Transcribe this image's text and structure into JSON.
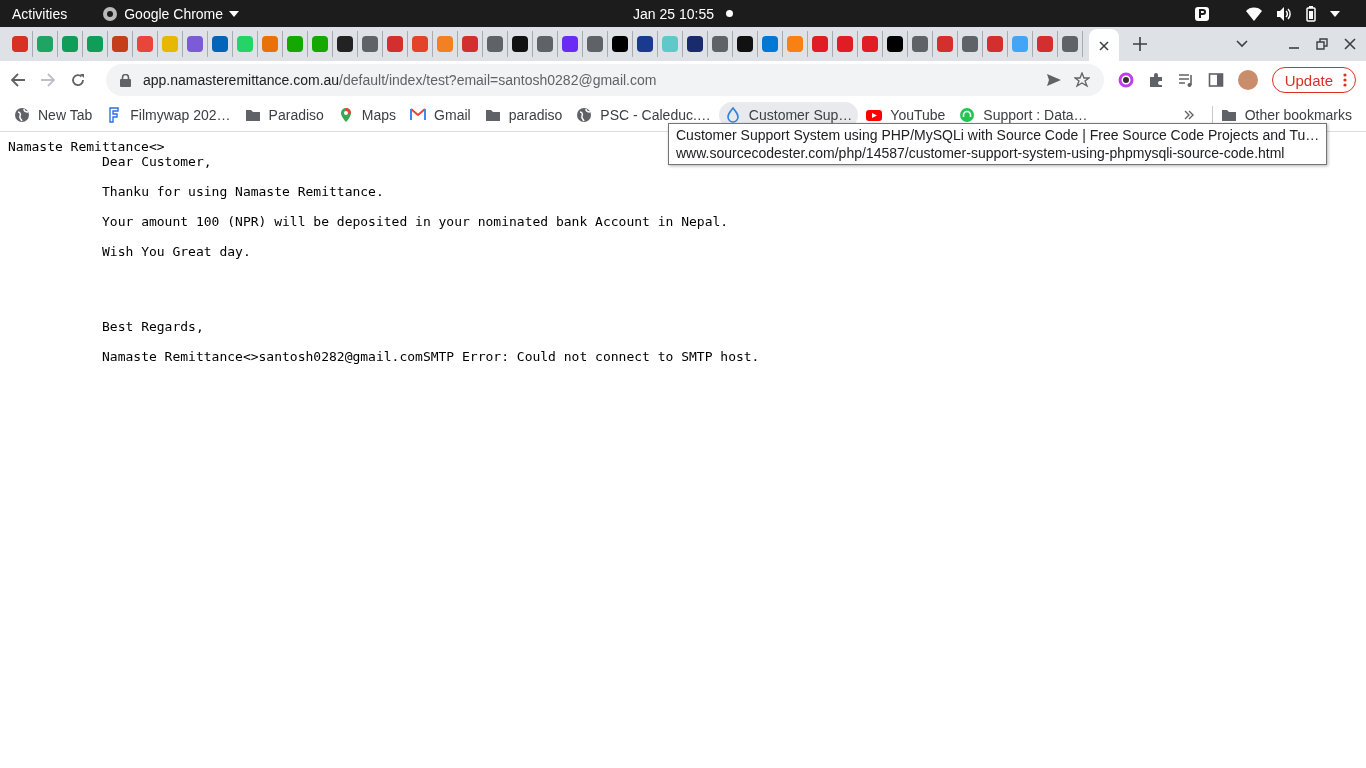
{
  "top_bar": {
    "activities": "Activities",
    "app_name": "Google Chrome",
    "clock": "Jan 25  10:55"
  },
  "tabs": [
    {
      "color": "#d93025"
    },
    {
      "color": "#1fa463"
    },
    {
      "color": "#0f9d58"
    },
    {
      "color": "#0f9d58"
    },
    {
      "color": "#c43e1c"
    },
    {
      "color": "#e8453c"
    },
    {
      "color": "#e6b800"
    },
    {
      "color": "#7b5cd6"
    },
    {
      "color": "#0364b8"
    },
    {
      "color": "#25d366"
    },
    {
      "color": "#e8710a"
    },
    {
      "color": "#14a800"
    },
    {
      "color": "#14a800"
    },
    {
      "color": "#222222"
    },
    {
      "color": "#5f6368"
    },
    {
      "color": "#d32f2f"
    },
    {
      "color": "#e24329"
    },
    {
      "color": "#f48024"
    },
    {
      "color": "#d32f2f"
    },
    {
      "color": "#5f6368"
    },
    {
      "color": "#111111"
    },
    {
      "color": "#5f6368"
    },
    {
      "color": "#6a2cf5"
    },
    {
      "color": "#5f6368"
    },
    {
      "color": "#000000"
    },
    {
      "color": "#1a3a8f"
    },
    {
      "color": "#5fc8c8"
    },
    {
      "color": "#1a2b6d"
    },
    {
      "color": "#5f6368"
    },
    {
      "color": "#111111"
    },
    {
      "color": "#0078d4"
    },
    {
      "color": "#f98012"
    },
    {
      "color": "#e01c24"
    },
    {
      "color": "#e01c24"
    },
    {
      "color": "#e01c24"
    },
    {
      "color": "#000000"
    },
    {
      "color": "#5f6368"
    },
    {
      "color": "#d32f2f"
    },
    {
      "color": "#5f6368"
    },
    {
      "color": "#d32f2f"
    },
    {
      "color": "#42a5f5"
    },
    {
      "color": "#d32f2f"
    },
    {
      "color": "#5f6368"
    }
  ],
  "address_bar": {
    "host": "app.namasteremittance.com.au",
    "path": "/default/index/test?email=santosh0282@gmail.com"
  },
  "update_button": "Update",
  "bookmarks": [
    {
      "kind": "globe",
      "label": "New Tab",
      "hovered": false
    },
    {
      "kind": "letter",
      "label": "Filmywap 202…",
      "hovered": false
    },
    {
      "kind": "folder",
      "label": "Paradiso",
      "hovered": false
    },
    {
      "kind": "pin",
      "label": "Maps",
      "hovered": false
    },
    {
      "kind": "mail",
      "label": "Gmail",
      "hovered": false
    },
    {
      "kind": "folder",
      "label": "paradiso",
      "hovered": false
    },
    {
      "kind": "globe",
      "label": "PSC - Caleduc.…",
      "hovered": false
    },
    {
      "kind": "drop",
      "label": "Customer Sup…",
      "hovered": true
    },
    {
      "kind": "video",
      "label": "YouTube",
      "hovered": false
    },
    {
      "kind": "headset",
      "label": "Support : Data…",
      "hovered": false
    }
  ],
  "other_bookmarks": "Other bookmarks",
  "tooltip": {
    "title": "Customer Support System using PHP/MySQLi with Source Code | Free Source Code Projects and Tu…",
    "url": "www.sourcecodester.com/php/14587/customer-support-system-using-phpmysqli-source-code.html"
  },
  "page": {
    "header": "Namaste Remittance<>",
    "paragraphs": [
      "Dear Customer,",
      "Thanku for using Namaste Remittance.",
      "Your amount 100 (NPR) will be deposited in your nominated bank Account in Nepal.",
      "Wish You Great day."
    ],
    "closing": [
      "Best Regards,",
      "Namaste Remittance<>santosh0282@gmail.comSMTP Error: Could not connect to SMTP host."
    ]
  }
}
